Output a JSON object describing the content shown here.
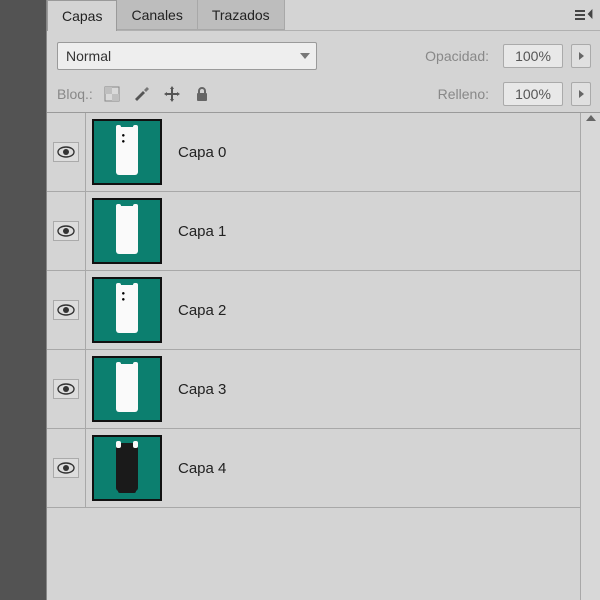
{
  "panel": {
    "tabs": [
      {
        "label": "Capas",
        "active": true
      },
      {
        "label": "Canales",
        "active": false
      },
      {
        "label": "Trazados",
        "active": false
      }
    ],
    "blend_mode": "Normal",
    "opacity": {
      "label": "Opacidad:",
      "value": "100%"
    },
    "lock": {
      "label": "Bloq.:",
      "icons": [
        "transparency-lock",
        "paint-lock",
        "move-lock",
        "full-lock"
      ]
    },
    "fill": {
      "label": "Relleno:",
      "value": "100%"
    }
  },
  "layers": [
    {
      "name": "Capa 0",
      "visible": true,
      "variant": "light",
      "face": "● ●"
    },
    {
      "name": "Capa 1",
      "visible": true,
      "variant": "light",
      "face": ""
    },
    {
      "name": "Capa 2",
      "visible": true,
      "variant": "light",
      "face": "● ●"
    },
    {
      "name": "Capa 3",
      "visible": true,
      "variant": "light",
      "face": ""
    },
    {
      "name": "Capa 4",
      "visible": true,
      "variant": "dark",
      "face": ""
    }
  ]
}
